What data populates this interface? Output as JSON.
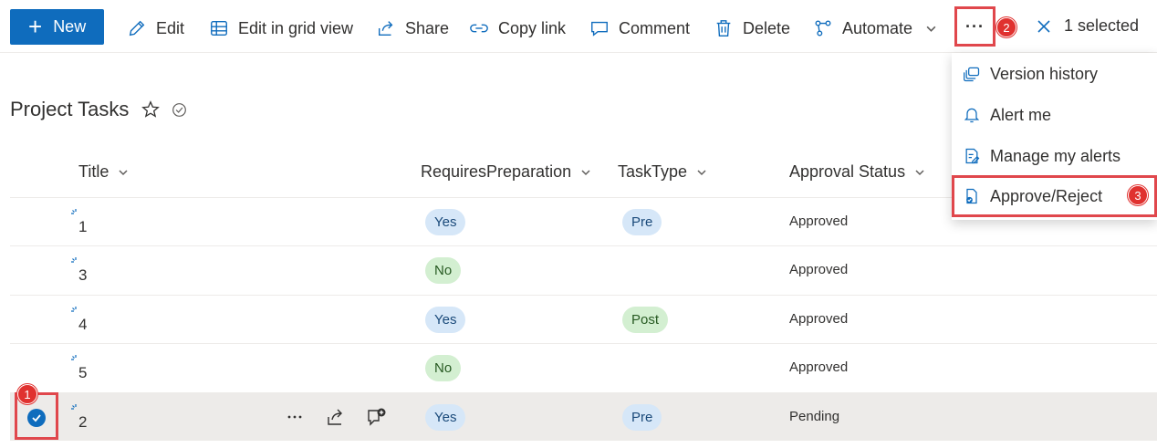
{
  "toolbar": {
    "new_label": "New",
    "edit_label": "Edit",
    "grid_label": "Edit in grid view",
    "share_label": "Share",
    "copylink_label": "Copy link",
    "comment_label": "Comment",
    "delete_label": "Delete",
    "automate_label": "Automate",
    "more_label": "···",
    "selected_label": "1 selected"
  },
  "page": {
    "title": "Project Tasks"
  },
  "table": {
    "columns": [
      "Title",
      "RequiresPreparation",
      "TaskType",
      "Approval Status"
    ],
    "rows": [
      {
        "title": "1",
        "requires": "Yes",
        "type": "Pre",
        "status": "Approved"
      },
      {
        "title": "3",
        "requires": "No",
        "type": "",
        "status": "Approved"
      },
      {
        "title": "4",
        "requires": "Yes",
        "type": "Post",
        "status": "Approved"
      },
      {
        "title": "5",
        "requires": "No",
        "type": "",
        "status": "Approved"
      },
      {
        "title": "2",
        "requires": "Yes",
        "type": "Pre",
        "status": "Pending"
      }
    ]
  },
  "menu": {
    "items": [
      "Version history",
      "Alert me",
      "Manage my alerts",
      "Approve/Reject"
    ]
  },
  "annotations": {
    "step1": "1",
    "step2": "2",
    "step3": "3"
  },
  "colors": {
    "accent": "#0f6cbd",
    "highlight": "#e0474c",
    "badge": "#e0312f"
  }
}
